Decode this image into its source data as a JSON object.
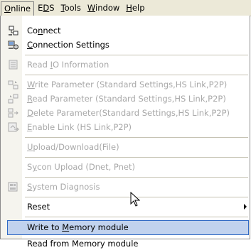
{
  "menubar": {
    "items": [
      {
        "pre": "",
        "u": "O",
        "post": "nline"
      },
      {
        "pre": "E",
        "u": "D",
        "post": "S"
      },
      {
        "pre": "",
        "u": "T",
        "post": "ools"
      },
      {
        "pre": "",
        "u": "W",
        "post": "indow"
      },
      {
        "pre": "",
        "u": "H",
        "post": "elp"
      }
    ]
  },
  "menu": {
    "connect": {
      "pre": "Co",
      "u": "n",
      "post": "nect"
    },
    "connection_settings": {
      "pre": "",
      "u": "C",
      "post": "onnection Settings"
    },
    "read_io": {
      "pre": "Read ",
      "u": "I",
      "post": "O Information"
    },
    "write_param": {
      "pre": "",
      "u": "W",
      "post": "rite Parameter (Standard Settings,HS Link,P2P)"
    },
    "read_param": {
      "pre": "",
      "u": "R",
      "post": "ead Parameter (Standard Settings,HS Link,P2P)"
    },
    "delete_param": {
      "pre": "",
      "u": "D",
      "post": "elete Parameter(Standard Settings,HS Link,P2P)"
    },
    "enable_link": {
      "pre": "",
      "u": "E",
      "post": "nable Link (HS Link,P2P)"
    },
    "upload_download": {
      "pre": "",
      "u": "U",
      "post": "pload/Download(File)"
    },
    "sycon_upload": {
      "pre": "S",
      "u": "y",
      "post": "con Upload (Dnet, Pnet)"
    },
    "system_diagnosis": {
      "pre": "",
      "u": "S",
      "post": "ystem Diagnosis"
    },
    "reset": {
      "pre": "Reset",
      "u": "",
      "post": ""
    },
    "write_memory": {
      "pre": "Write to ",
      "u": "M",
      "post": "emory module"
    },
    "read_memory": {
      "pre": "Read from Memory module",
      "u": "",
      "post": ""
    }
  },
  "colors": {
    "highlight_bg": "#c1d2ee",
    "highlight_border": "#316ac5",
    "disabled_text": "#a8a8a8"
  }
}
